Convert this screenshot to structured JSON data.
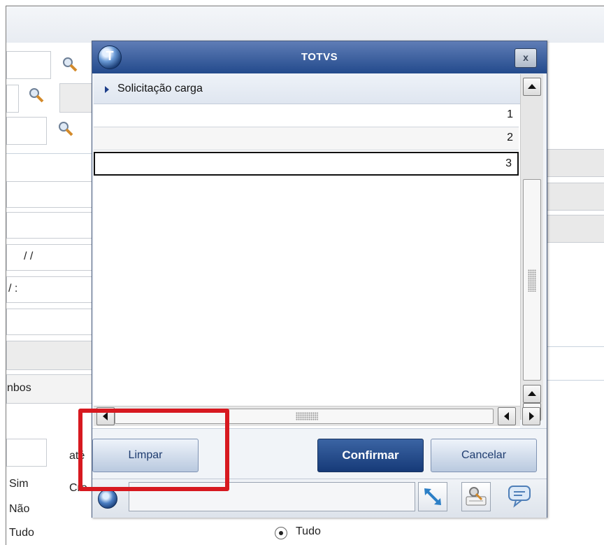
{
  "dialog": {
    "title": "TOTVS",
    "logo_letter": "T",
    "close_label": "x",
    "list_header": "Solicitação carga",
    "rows": [
      "1",
      "2",
      "3"
    ],
    "buttons": {
      "clear": "Limpar",
      "confirm": "Confirmar",
      "cancel": "Cancelar"
    },
    "icons": [
      "totvs-logo-icon",
      "resize-icon",
      "settings-icon",
      "chat-icon"
    ]
  },
  "background": {
    "date_placeholder": " / /",
    "time_placeholder": "/ :",
    "button_text": "nbos",
    "until_label": "até",
    "cro_label": "Cro",
    "options": [
      "Sim",
      "Não",
      "Tudo"
    ],
    "radio_label": "Tudo"
  },
  "colors": {
    "annotation": "#d71920",
    "titlebar": "#2b4f8f",
    "confirm_button": "#1f447f"
  }
}
